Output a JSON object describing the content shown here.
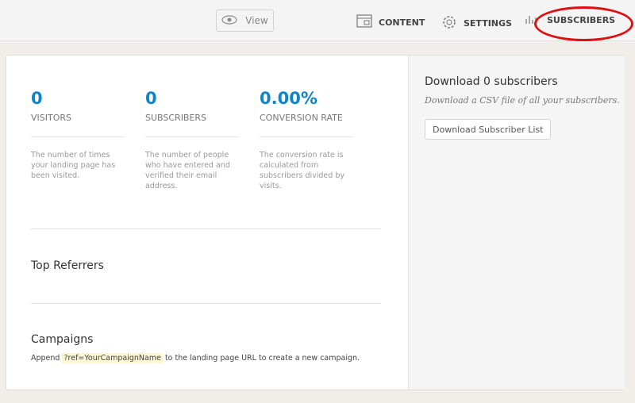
{
  "header": {
    "view_label": "View",
    "nav": [
      {
        "label": "CONTENT",
        "icon": "content-icon"
      },
      {
        "label": "SETTINGS",
        "icon": "gear-icon"
      },
      {
        "label": "SUBSCRIBERS",
        "icon": "bar-chart-icon"
      }
    ]
  },
  "stats": [
    {
      "value": "0",
      "label": "VISITORS",
      "desc": "The number of times your landing page has been visited."
    },
    {
      "value": "0",
      "label": "SUBSCRIBERS",
      "desc": "The number of people who have entered and verified their email address."
    },
    {
      "value": "0.00%",
      "label": "CONVERSION RATE",
      "desc": "The conversion rate is calculated from subscribers divided by visits."
    }
  ],
  "top_referrers": {
    "title": "Top Referrers"
  },
  "campaigns": {
    "title": "Campaigns",
    "pre": "Append ",
    "code": "?ref=YourCampaignName",
    "post": " to the landing page URL to create a new campaign."
  },
  "download": {
    "title": "Download 0 subscribers",
    "subtitle": "Download a CSV file of all your subscribers.",
    "button": "Download Subscriber List"
  },
  "colors": {
    "accent": "#0e84cb",
    "annotation": "#e01010"
  }
}
